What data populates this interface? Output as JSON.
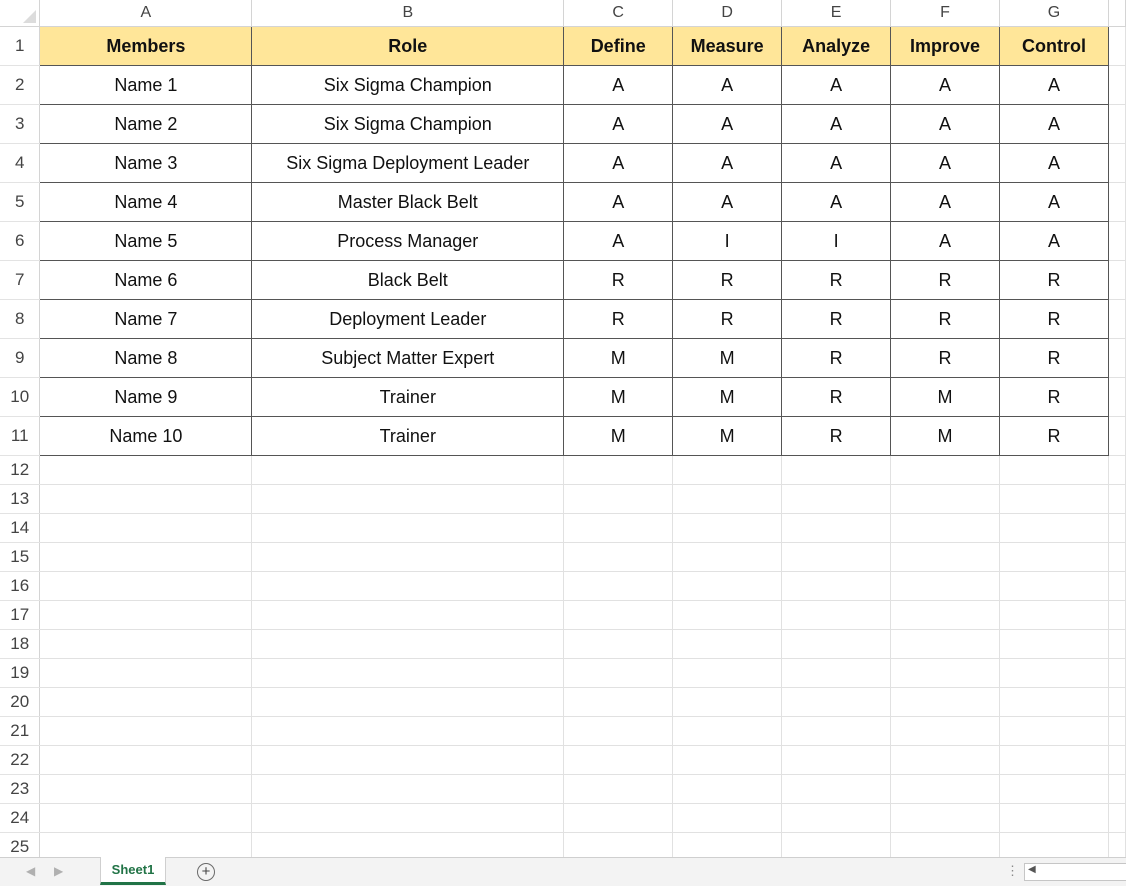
{
  "column_headers": [
    "A",
    "B",
    "C",
    "D",
    "E",
    "F",
    "G"
  ],
  "row_numbers": [
    "1",
    "2",
    "3",
    "4",
    "5",
    "6",
    "7",
    "8",
    "9",
    "10",
    "11",
    "12",
    "13",
    "14",
    "15",
    "16",
    "17",
    "18",
    "19",
    "20",
    "21",
    "22",
    "23",
    "24",
    "25"
  ],
  "table": {
    "headers": [
      "Members",
      "Role",
      "Define",
      "Measure",
      "Analyze",
      "Improve",
      "Control"
    ],
    "rows": [
      [
        "Name 1",
        "Six Sigma Champion",
        "A",
        "A",
        "A",
        "A",
        "A"
      ],
      [
        "Name 2",
        "Six Sigma Champion",
        "A",
        "A",
        "A",
        "A",
        "A"
      ],
      [
        "Name 3",
        "Six Sigma Deployment Leader",
        "A",
        "A",
        "A",
        "A",
        "A"
      ],
      [
        "Name 4",
        "Master Black Belt",
        "A",
        "A",
        "A",
        "A",
        "A"
      ],
      [
        "Name 5",
        "Process Manager",
        "A",
        "I",
        "I",
        "A",
        "A"
      ],
      [
        "Name 6",
        "Black Belt",
        "R",
        "R",
        "R",
        "R",
        "R"
      ],
      [
        "Name 7",
        "Deployment Leader",
        "R",
        "R",
        "R",
        "R",
        "R"
      ],
      [
        "Name 8",
        "Subject Matter Expert",
        "M",
        "M",
        "R",
        "R",
        "R"
      ],
      [
        "Name 9",
        "Trainer",
        "M",
        "M",
        "R",
        "M",
        "R"
      ],
      [
        "Name 10",
        "Trainer",
        "M",
        "M",
        "R",
        "M",
        "R"
      ]
    ]
  },
  "sheet_tab": {
    "label": "Sheet1",
    "add_icon": "plus-circle-icon",
    "prev_icon": "chevron-left-icon",
    "next_icon": "chevron-right-icon"
  },
  "colors": {
    "header_fill": "#ffe699",
    "sheet_tab_accent": "#217346",
    "table_border": "#555555"
  }
}
